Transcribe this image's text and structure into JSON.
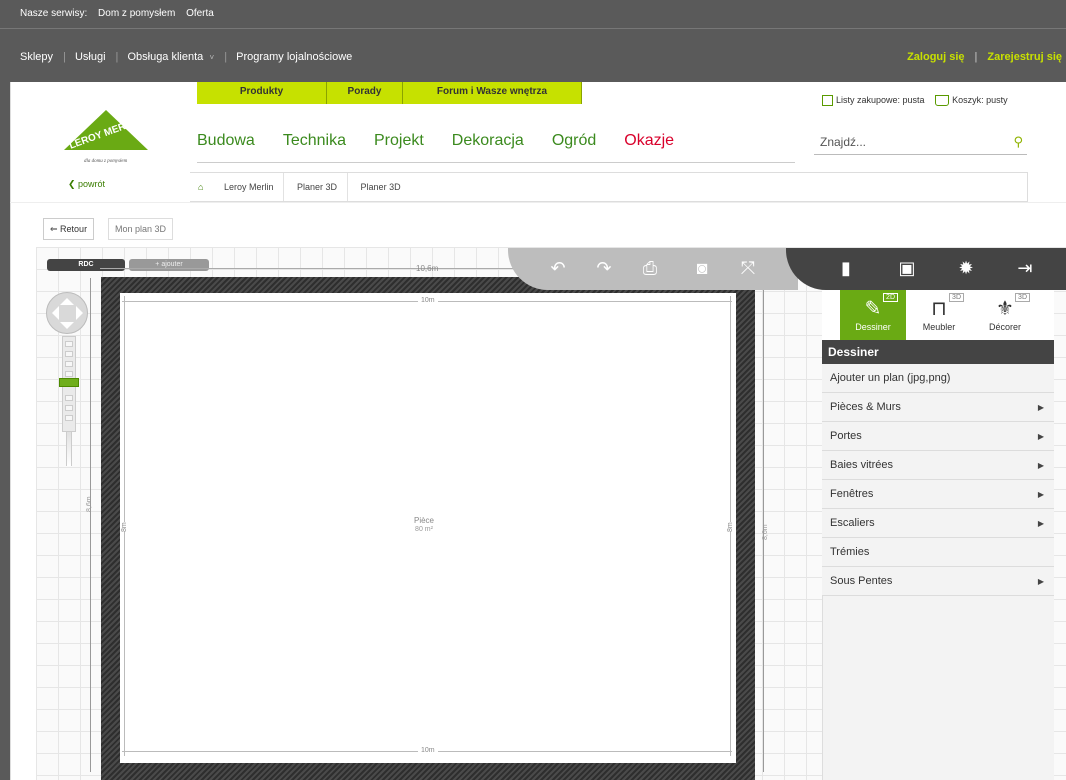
{
  "top_services": {
    "label": "Nasze serwisy:",
    "links": [
      "Dom z pomysłem",
      "Oferta"
    ]
  },
  "sub_nav": {
    "left": [
      "Sklepy",
      "Usługi",
      "Obsługa klienta",
      "Programy lojalnościowe"
    ],
    "login": "Zaloguj się",
    "register": "Zarejestruj się"
  },
  "tabs": [
    "Produkty",
    "Porady",
    "Forum i Wasze wnętrza"
  ],
  "logo": {
    "brand": "LEROY MERLIN",
    "tagline": "dla domu z pomysłem"
  },
  "back_link": "powrót",
  "main_nav": [
    "Budowa",
    "Technika",
    "Projekt",
    "Dekoracja",
    "Ogród",
    "Okazje"
  ],
  "lists": {
    "shopping_lists": "Listy zakupowe: pusta",
    "cart": "Koszyk: pusty"
  },
  "search": {
    "placeholder": "Znajdź..."
  },
  "breadcrumb": [
    "Leroy Merlin",
    "Planer 3D",
    "Planer 3D"
  ],
  "plan_buttons": {
    "retour": "Retour",
    "mon_plan": "Mon plan 3D"
  },
  "editor": {
    "level": "RDC",
    "add_level": "+ ajouter",
    "top_dimension": "10,6m",
    "left_dimension": "8,6m",
    "right_dimension": "8,6m",
    "room": {
      "name": "Pièce",
      "area": "80 m²",
      "width": "10m",
      "height": "8m"
    }
  },
  "toolbar_icons": [
    "undo-icon",
    "redo-icon",
    "print-icon",
    "camera-icon",
    "fullscreen-icon"
  ],
  "toolbar_right_icons": [
    "new-file-icon",
    "save-icon",
    "settings-icon",
    "exit-icon"
  ],
  "panel": {
    "modes": [
      {
        "label": "Dessiner",
        "badge": "2D",
        "icon": "pencil-icon"
      },
      {
        "label": "Meubler",
        "badge": "3D",
        "icon": "furniture-icon"
      },
      {
        "label": "Décorer",
        "badge": "3D",
        "icon": "decorate-icon"
      }
    ],
    "title": "Dessiner",
    "items": [
      {
        "label": "Ajouter un plan (jpg,png)",
        "has_arrow": false
      },
      {
        "label": "Pièces & Murs",
        "has_arrow": true
      },
      {
        "label": "Portes",
        "has_arrow": true
      },
      {
        "label": "Baies vitrées",
        "has_arrow": true
      },
      {
        "label": "Fenêtres",
        "has_arrow": true
      },
      {
        "label": "Escaliers",
        "has_arrow": true
      },
      {
        "label": "Trémies",
        "has_arrow": false
      },
      {
        "label": "Sous Pentes",
        "has_arrow": true
      }
    ]
  },
  "colors": {
    "accent_green": "#6aaa14",
    "tab_lime": "#c6e100",
    "okazje_red": "#d9002b",
    "topbar_gray": "#5a5a5a",
    "panel_dark": "#444444"
  }
}
